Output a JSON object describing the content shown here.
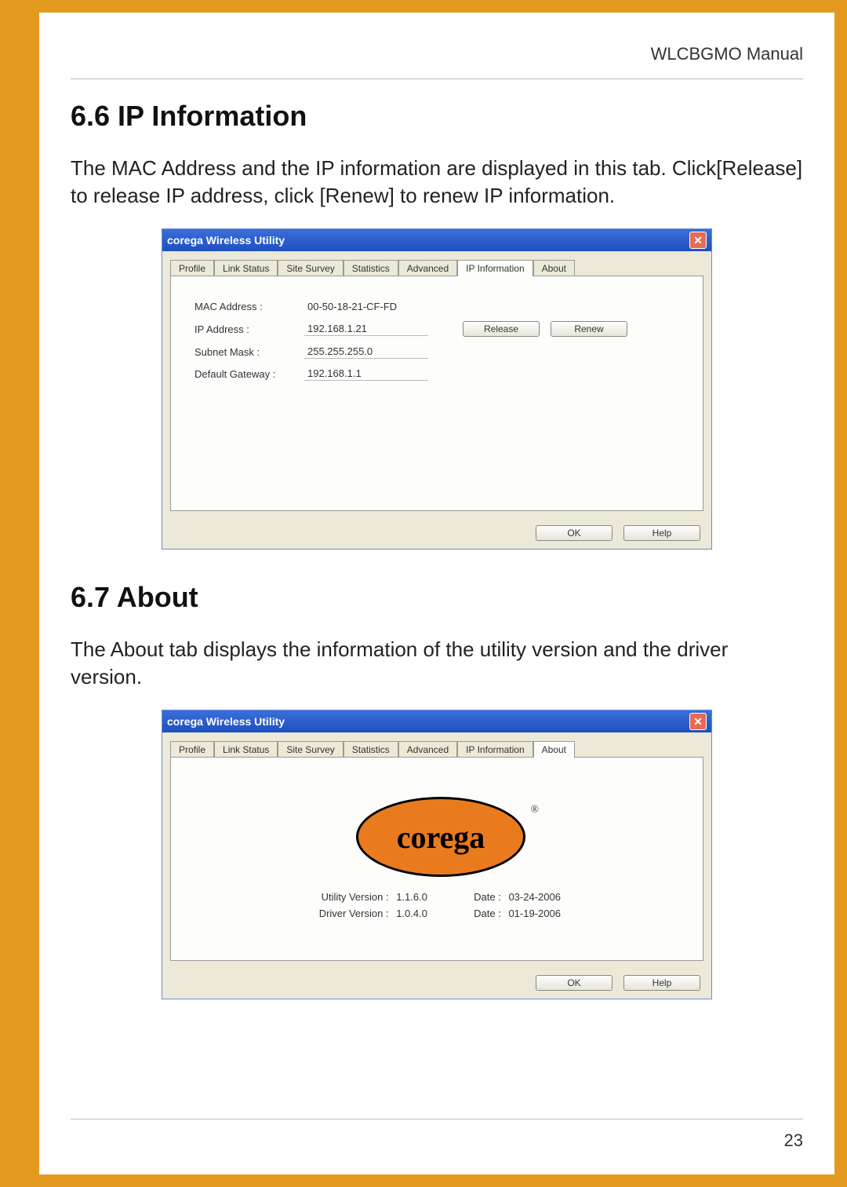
{
  "doc": {
    "header": "WLCBGMO  Manual",
    "page_number": "23",
    "sections": {
      "ip": {
        "heading": "6.6  IP Information",
        "paragraph": "The MAC Address and the IP information are displayed in this tab. Click[Release] to release IP address, click [Renew] to renew IP information."
      },
      "about": {
        "heading": "6.7 About",
        "paragraph": "The About tab displays the information of the utility version and the driver version."
      }
    }
  },
  "dialog_common": {
    "title": "corega Wireless Utility",
    "close_glyph": "✕",
    "tabs": [
      "Profile",
      "Link Status",
      "Site Survey",
      "Statistics",
      "Advanced",
      "IP Information",
      "About"
    ],
    "ok_label": "OK",
    "help_label": "Help"
  },
  "ip_dialog": {
    "active_tab_index": 5,
    "mac_label": "MAC Address :",
    "mac_value": "00-50-18-21-CF-FD",
    "ip_label": "IP Address :",
    "ip_value": "192.168.1.21",
    "subnet_label": "Subnet Mask :",
    "subnet_value": "255.255.255.0",
    "gateway_label": "Default Gateway :",
    "gateway_value": "192.168.1.1",
    "release_label": "Release",
    "renew_label": "Renew"
  },
  "about_dialog": {
    "active_tab_index": 6,
    "logo_text": "corega",
    "reg_mark": "®",
    "utility_label": "Utility Version :",
    "utility_value": "1.1.6.0",
    "driver_label": "Driver Version :",
    "driver_value": "1.0.4.0",
    "date_label": "Date :",
    "utility_date": "03-24-2006",
    "driver_date": "01-19-2006"
  }
}
